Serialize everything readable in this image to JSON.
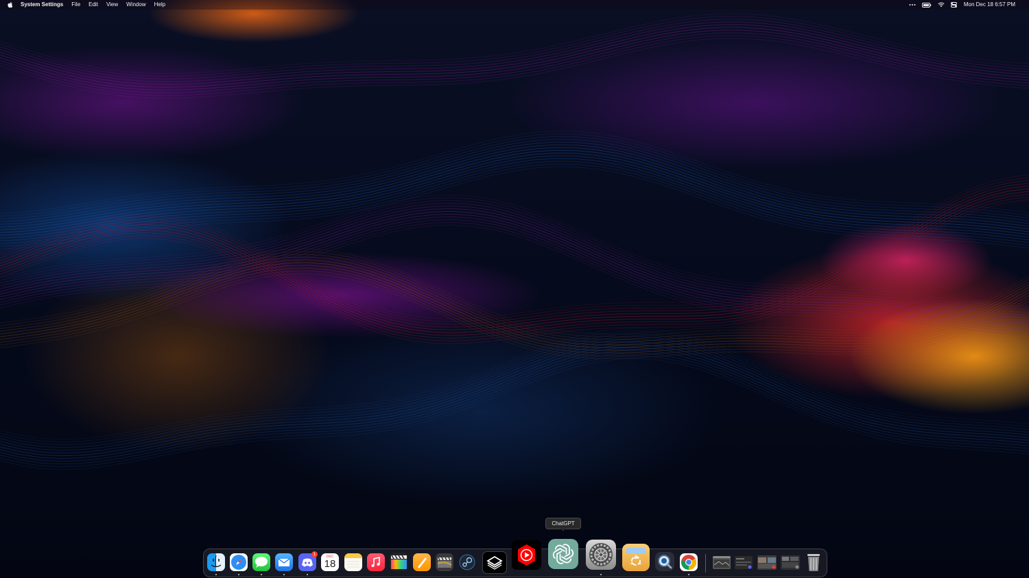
{
  "menubar": {
    "app_name": "System Settings",
    "menus": [
      "File",
      "Edit",
      "View",
      "Window",
      "Help"
    ],
    "status_icons": [
      "more-icon",
      "battery-icon",
      "wifi-icon",
      "control-center-icon"
    ],
    "clock": "Mon Dec 18  6:57 PM"
  },
  "tooltip": {
    "label": "ChatGPT"
  },
  "dock": {
    "apps": [
      {
        "name": "Finder",
        "icon": "finder-icon",
        "running": true
      },
      {
        "name": "Safari",
        "icon": "safari-icon",
        "running": true
      },
      {
        "name": "Messages",
        "icon": "messages-icon",
        "running": true
      },
      {
        "name": "Mail",
        "icon": "mail-icon",
        "running": true
      },
      {
        "name": "Discord",
        "icon": "discord-icon",
        "running": true,
        "badge": "1"
      },
      {
        "name": "Calendar",
        "icon": "calendar-icon",
        "running": false,
        "month": "DEC",
        "day": "18"
      },
      {
        "name": "Notes",
        "icon": "notes-icon",
        "running": false
      },
      {
        "name": "Music",
        "icon": "music-icon",
        "running": false
      },
      {
        "name": "Final Cut Pro",
        "icon": "final-cut-icon",
        "running": false
      },
      {
        "name": "Pages",
        "icon": "pages-icon",
        "running": false
      },
      {
        "name": "Compressor",
        "icon": "clapper-icon",
        "running": false
      },
      {
        "name": "Steam",
        "icon": "steam-icon",
        "running": false
      },
      {
        "name": "Sketch",
        "icon": "cube-icon",
        "running": false
      },
      {
        "name": "YouTube",
        "icon": "youtube-icon",
        "running": false
      },
      {
        "name": "ChatGPT",
        "icon": "chatgpt-icon",
        "running": false
      },
      {
        "name": "System Settings",
        "icon": "settings-gear-icon",
        "running": true
      },
      {
        "name": "Archive Utility",
        "icon": "recycle-box-icon",
        "running": false
      },
      {
        "name": "QuickTime",
        "icon": "quicktime-icon",
        "running": false
      },
      {
        "name": "Chrome",
        "icon": "chrome-icon",
        "running": true
      }
    ],
    "minimized": [
      {
        "name": "Window 1",
        "icon": "minimized-window-icon"
      },
      {
        "name": "Window 2",
        "icon": "minimized-window-icon"
      },
      {
        "name": "Window 3",
        "icon": "minimized-window-icon"
      },
      {
        "name": "Window 4",
        "icon": "minimized-window-icon"
      }
    ],
    "trash": {
      "name": "Trash",
      "icon": "trash-icon"
    }
  },
  "colors": {
    "accent_orange": "#ff8a00",
    "accent_magenta": "#9a1aa8",
    "accent_red": "#e02a3a",
    "chatgpt_green": "#74aa9c"
  }
}
